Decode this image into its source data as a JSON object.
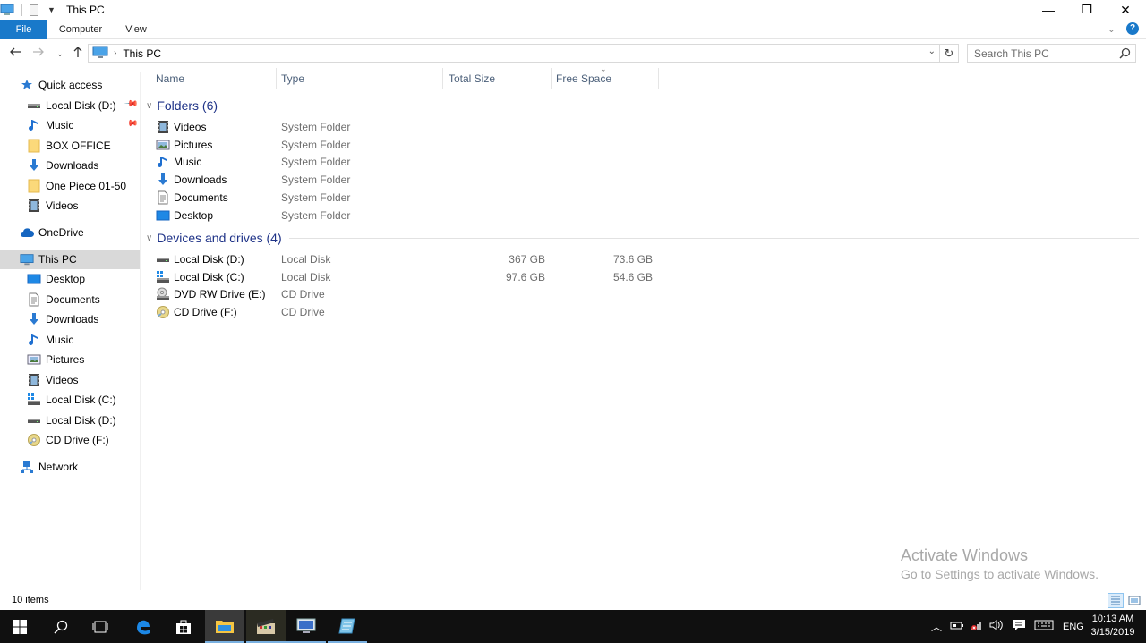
{
  "window": {
    "title": "This PC",
    "controls": {
      "minimize": "—",
      "restore": "❐",
      "close": "✕"
    }
  },
  "ribbon": {
    "tabs": [
      "File",
      "Computer",
      "View"
    ]
  },
  "address": {
    "breadcrumb": "This PC",
    "search_placeholder": "Search This PC"
  },
  "sidebar": {
    "items": [
      {
        "label": "Quick access",
        "icon": "star-icon",
        "indent": 1,
        "pinned": false
      },
      {
        "label": "Local Disk (D:)",
        "icon": "drive-icon",
        "indent": 2,
        "pinned": true
      },
      {
        "label": "Music",
        "icon": "music-icon",
        "indent": 2,
        "pinned": true
      },
      {
        "label": "BOX OFFICE",
        "icon": "folder-icon",
        "indent": 2,
        "pinned": false
      },
      {
        "label": "Downloads",
        "icon": "download-icon",
        "indent": 2,
        "pinned": false
      },
      {
        "label": "One Piece 01-50",
        "icon": "folder-icon",
        "indent": 2,
        "pinned": false
      },
      {
        "label": "Videos",
        "icon": "video-icon",
        "indent": 2,
        "pinned": false
      },
      {
        "label": "OneDrive",
        "icon": "cloud-icon",
        "indent": 1,
        "pinned": false
      },
      {
        "label": "This PC",
        "icon": "computer-icon",
        "indent": 1,
        "pinned": false,
        "selected": true
      },
      {
        "label": "Desktop",
        "icon": "desktop-icon",
        "indent": 2,
        "pinned": false
      },
      {
        "label": "Documents",
        "icon": "document-icon",
        "indent": 2,
        "pinned": false
      },
      {
        "label": "Downloads",
        "icon": "download-icon",
        "indent": 2,
        "pinned": false
      },
      {
        "label": "Music",
        "icon": "music-icon",
        "indent": 2,
        "pinned": false
      },
      {
        "label": "Pictures",
        "icon": "picture-icon",
        "indent": 2,
        "pinned": false
      },
      {
        "label": "Videos",
        "icon": "video-icon",
        "indent": 2,
        "pinned": false
      },
      {
        "label": "Local Disk (C:)",
        "icon": "system-drive-icon",
        "indent": 2,
        "pinned": false
      },
      {
        "label": "Local Disk (D:)",
        "icon": "drive-icon",
        "indent": 2,
        "pinned": false
      },
      {
        "label": "CD Drive (F:)",
        "icon": "cd-icon",
        "indent": 2,
        "pinned": false
      },
      {
        "label": "Network",
        "icon": "network-icon",
        "indent": 1,
        "pinned": false
      }
    ]
  },
  "columns": [
    "Name",
    "Type",
    "Total Size",
    "Free Space"
  ],
  "groups": {
    "folders": {
      "label": "Folders (6)",
      "items": [
        {
          "name": "Videos",
          "type": "System Folder",
          "icon": "video-icon"
        },
        {
          "name": "Pictures",
          "type": "System Folder",
          "icon": "picture-icon"
        },
        {
          "name": "Music",
          "type": "System Folder",
          "icon": "music-icon"
        },
        {
          "name": "Downloads",
          "type": "System Folder",
          "icon": "download-icon"
        },
        {
          "name": "Documents",
          "type": "System Folder",
          "icon": "document-icon"
        },
        {
          "name": "Desktop",
          "type": "System Folder",
          "icon": "desktop-icon"
        }
      ]
    },
    "drives": {
      "label": "Devices and drives (4)",
      "items": [
        {
          "name": "Local Disk (D:)",
          "type": "Local Disk",
          "total": "367 GB",
          "free": "73.6 GB",
          "icon": "drive-icon"
        },
        {
          "name": "Local Disk (C:)",
          "type": "Local Disk",
          "total": "97.6 GB",
          "free": "54.6 GB",
          "icon": "system-drive-icon"
        },
        {
          "name": "DVD RW Drive (E:)",
          "type": "CD Drive",
          "total": "",
          "free": "",
          "icon": "dvd-drive-icon"
        },
        {
          "name": "CD Drive (F:)",
          "type": "CD Drive",
          "total": "",
          "free": "",
          "icon": "cd-icon"
        }
      ]
    }
  },
  "status": {
    "item_count": "10 items"
  },
  "watermark": {
    "line1": "Activate Windows",
    "line2": "Go to Settings to activate Windows."
  },
  "taskbar": {
    "apps": [
      "start-icon",
      "search-icon",
      "task-view-icon",
      "edge-icon",
      "store-icon",
      "file-explorer-icon",
      "video-editor-icon",
      "remote-desktop-icon",
      "notepad-icon"
    ],
    "language": "ENG",
    "time": "10:13 AM",
    "date": "3/15/2019"
  },
  "colors": {
    "accent": "#1979ca",
    "group_header": "#1e3287",
    "column_header": "#4c607a",
    "secondary_text": "#6d6d6d",
    "selection": "#d9d9d9",
    "taskbar": "#101010"
  }
}
